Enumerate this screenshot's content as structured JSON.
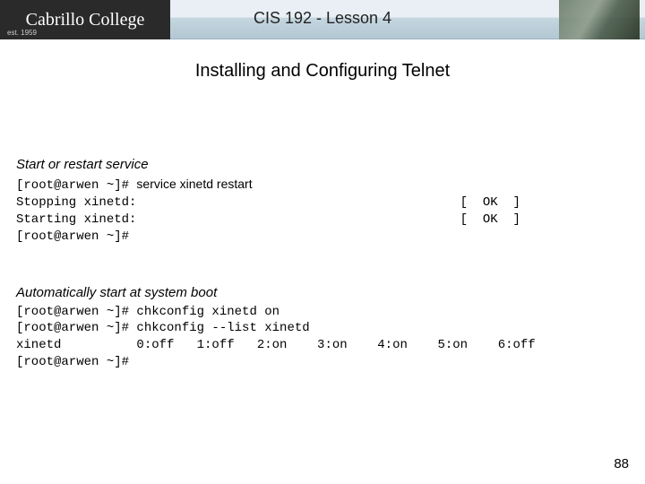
{
  "header": {
    "logo_text": "Cabrillo College",
    "logo_est": "est. 1959",
    "title": "CIS 192 - Lesson 4"
  },
  "slide": {
    "title": "Installing and Configuring Telnet"
  },
  "section1": {
    "label": "Start or restart service",
    "line1_prompt": "[root@arwen ~]# ",
    "line1_cmd": "service xinetd restart",
    "line2": "Stopping xinetd:                                           [  OK  ]",
    "line3": "Starting xinetd:                                           [  OK  ]",
    "line4": "[root@arwen ~]#"
  },
  "section2": {
    "label": "Automatically start at system boot",
    "line1": "[root@arwen ~]# chkconfig xinetd on",
    "line2": "[root@arwen ~]# chkconfig --list xinetd",
    "line3": "xinetd          0:off   1:off   2:on    3:on    4:on    5:on    6:off",
    "line4": "[root@arwen ~]#"
  },
  "page_number": "88"
}
